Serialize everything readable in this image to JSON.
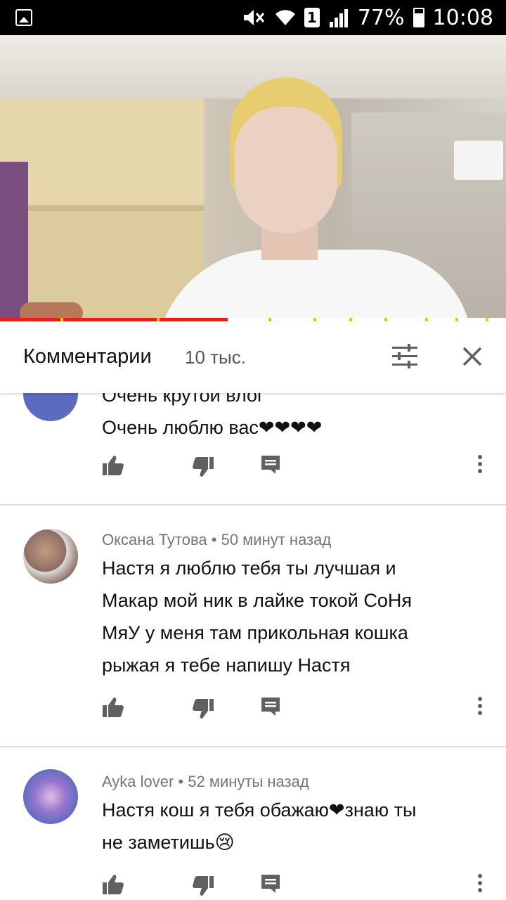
{
  "status_bar": {
    "battery": "77%",
    "battery_level": 0.77,
    "time": "10:08",
    "sim": "1",
    "icons": [
      "gallery-icon",
      "mute-icon",
      "wifi-icon",
      "sim-icon",
      "signal-icon",
      "battery-icon"
    ]
  },
  "video": {
    "progress": 0.45,
    "ad_markers": [
      0.12,
      0.31,
      0.53,
      0.62,
      0.69,
      0.76,
      0.84,
      0.9,
      0.96
    ]
  },
  "comments_header": {
    "title": "Комментарии",
    "count": "10 тыс."
  },
  "comments": [
    {
      "author": "",
      "time": "",
      "text_lines": [
        "Очень крутой влог",
        "Очень люблю вас❤❤❤❤"
      ],
      "avatar_color": "#5c6bc0"
    },
    {
      "author": "Оксана Тутова",
      "time": "50 минут назад",
      "meta": "Оксана Тутова • 50 минут назад",
      "text_lines": [
        "Настя я люблю тебя ты лучшая и",
        "Макар мой ник в лайке токой СоНя",
        "МяУ у меня там прикольная кошка",
        "рыжая я тебе напишу Настя"
      ],
      "avatar_color": "#8d6e63"
    },
    {
      "author": "Ayka lover",
      "time": "52 минуты назад",
      "meta": "Ayka lover • 52 минуты назад",
      "text_lines": [
        "Настя кош я тебя обажаю❤знаю ты",
        "не заметишь😢"
      ],
      "avatar_color": "#7e57c2"
    }
  ],
  "colors": {
    "accent_red": "#e62117",
    "icon_grey": "#606060"
  }
}
